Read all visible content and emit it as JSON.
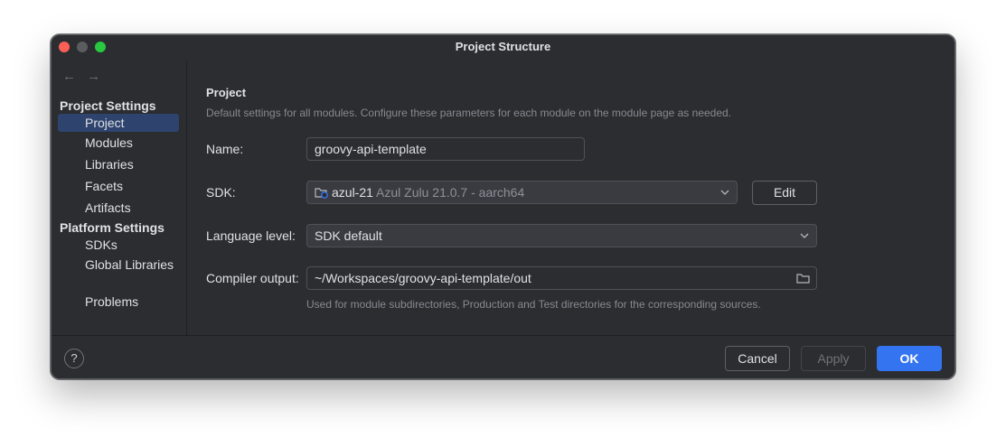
{
  "window": {
    "title": "Project Structure"
  },
  "sidebar": {
    "nav_back": "←",
    "nav_forward": "→",
    "project_settings_heading": "Project Settings",
    "project_items": [
      "Project",
      "Modules",
      "Libraries",
      "Facets",
      "Artifacts"
    ],
    "platform_settings_heading": "Platform Settings",
    "platform_items": [
      "SDKs",
      "Global Libraries"
    ],
    "problems": "Problems",
    "selected": "Project"
  },
  "main": {
    "title": "Project",
    "description": "Default settings for all modules. Configure these parameters for each module on the module page as needed.",
    "name_label": "Name:",
    "name_value": "groovy-api-template",
    "sdk_label": "SDK:",
    "sdk_name": "azul-21",
    "sdk_version": "Azul Zulu 21.0.7 - aarch64",
    "edit_button": "Edit",
    "language_level_label": "Language level:",
    "language_level_value": "SDK default",
    "compiler_output_label": "Compiler output:",
    "compiler_output_value": "~/Workspaces/groovy-api-template/out",
    "compiler_output_hint": "Used for module subdirectories, Production and Test directories for the corresponding sources."
  },
  "footer": {
    "help": "?",
    "cancel": "Cancel",
    "apply": "Apply",
    "ok": "OK"
  },
  "icons": {
    "sdk": "folder-with-java-badge-icon",
    "browse": "folder-icon",
    "dropdown": "chevron-down-icon"
  },
  "colors": {
    "accent": "#3574f0",
    "selection": "#2e436e",
    "background": "#2b2d30"
  }
}
